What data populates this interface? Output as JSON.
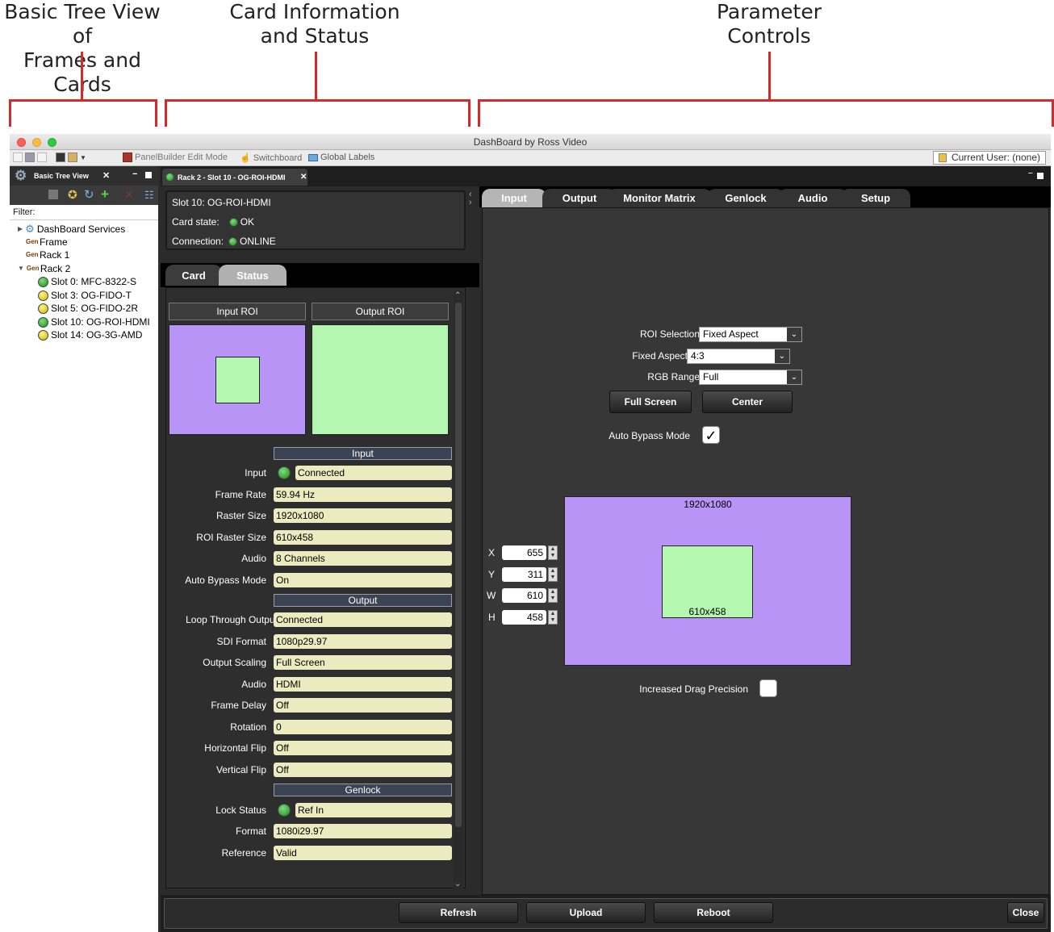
{
  "annotations": {
    "tree_caption": [
      "Basic Tree View of",
      "Frames and Cards"
    ],
    "card_caption": [
      "Card Information",
      "and Status"
    ],
    "param_caption": [
      "Parameter",
      "Controls"
    ]
  },
  "window": {
    "title": "DashBoard by Ross Video",
    "toolbar": {
      "panelbuilder": "PanelBuilder Edit Mode",
      "switchboard": "Switchboard",
      "global_labels": "Global Labels",
      "current_user": "Current User: (none)"
    }
  },
  "tree": {
    "tab_title": "Basic Tree View",
    "filter_label": "Filter:",
    "nodes": [
      {
        "label": "DashBoard Services",
        "icon": "services-icon"
      },
      {
        "label": "Frame",
        "icon": "frame-icon"
      },
      {
        "label": "Rack 1",
        "icon": "frame-icon"
      },
      {
        "label": "Rack 2",
        "icon": "frame-icon"
      },
      {
        "label": "Slot 0: MFC-8322-S",
        "status": "green"
      },
      {
        "label": "Slot 3: OG-FIDO-T",
        "status": "yellow"
      },
      {
        "label": "Slot 5: OG-FIDO-2R",
        "status": "yellow"
      },
      {
        "label": "Slot 10: OG-ROI-HDMI",
        "status": "green"
      },
      {
        "label": "Slot 14: OG-3G-AMD",
        "status": "yellow"
      }
    ]
  },
  "card": {
    "tab_title": "Rack 2 - Slot 10 - OG-ROI-HDMI",
    "slot": "Slot 10: OG-ROI-HDMI",
    "card_state_label": "Card state:",
    "card_state": "OK",
    "connection_label": "Connection:",
    "connection": "ONLINE",
    "subtabs": [
      "Card",
      "Status"
    ],
    "status": {
      "input_roi": "Input ROI",
      "output_roi": "Output ROI",
      "input_section": "Input",
      "output_section": "Output",
      "genlock_section": "Genlock",
      "input_rows": [
        {
          "label": "Input",
          "value": "Connected"
        },
        {
          "label": "Frame Rate",
          "value": "59.94 Hz"
        },
        {
          "label": "Raster Size",
          "value": "1920x1080"
        },
        {
          "label": "ROI Raster Size",
          "value": "610x458"
        },
        {
          "label": "Audio",
          "value": "8 Channels"
        },
        {
          "label": "Auto Bypass Mode",
          "value": "On"
        }
      ],
      "output_rows": [
        {
          "label": "Loop Through Output",
          "value": "Connected"
        },
        {
          "label": "SDI Format",
          "value": "1080p29.97"
        },
        {
          "label": "Output Scaling",
          "value": "Full Screen"
        },
        {
          "label": "Audio",
          "value": "HDMI"
        },
        {
          "label": "Frame Delay",
          "value": "Off"
        },
        {
          "label": "Rotation",
          "value": "0"
        },
        {
          "label": "Horizontal Flip",
          "value": "Off"
        },
        {
          "label": "Vertical Flip",
          "value": "Off"
        }
      ],
      "genlock_rows": [
        {
          "label": "Lock Status",
          "value": "Ref In"
        },
        {
          "label": "Format",
          "value": "1080i29.97"
        },
        {
          "label": "Reference",
          "value": "Valid"
        }
      ]
    }
  },
  "params": {
    "tabs": [
      "Input",
      "Output",
      "Monitor Matrix",
      "Genlock",
      "Audio",
      "Setup"
    ],
    "roi_selection_label": "ROI Selection",
    "roi_selection": "Fixed Aspect",
    "fixed_aspect_label": "Fixed Aspect",
    "fixed_aspect": "4:3",
    "rgb_range_label": "RGB Range",
    "rgb_range": "Full",
    "full_screen": "Full Screen",
    "center": "Center",
    "auto_bypass_label": "Auto Bypass Mode",
    "auto_bypass_checked": true,
    "raster": "1920x1080",
    "roi_size": "610x458",
    "x_label": "X",
    "x": "655",
    "y_label": "Y",
    "y": "311",
    "w_label": "W",
    "w": "610",
    "h_label": "H",
    "h": "458",
    "drag_precision_label": "Increased Drag Precision",
    "drag_precision_checked": false
  },
  "bottom": {
    "refresh": "Refresh",
    "upload": "Upload",
    "reboot": "Reboot",
    "close": "Close"
  },
  "colors": {
    "roi_outer": "#b794f6",
    "roi_inner": "#b3f7b0",
    "annotation_red": "#d42a2a"
  }
}
